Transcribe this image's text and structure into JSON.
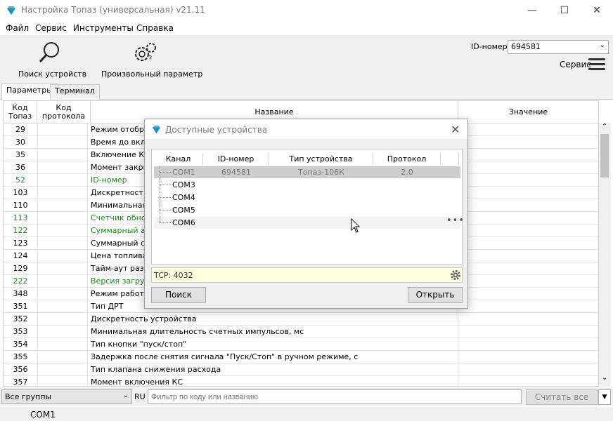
{
  "window": {
    "title": "Настройка Топаз (универсальная) v21.11",
    "minimize": "—",
    "maximize": "☐",
    "close": "✕"
  },
  "menu": [
    "Файл",
    "Сервис",
    "Инструменты",
    "Справка"
  ],
  "toolbar": {
    "search_label": "Поиск устройств",
    "param_label": "Произвольный параметр",
    "id_label": "ID-номер",
    "id_value": "694581",
    "service_label": "Сервис"
  },
  "tabs": [
    "Параметры",
    "Терминал"
  ],
  "grid": {
    "headers": {
      "code": "Код\nТопаз",
      "proto": "Код\nпротокола",
      "name": "Название",
      "value": "Значение"
    },
    "rows": [
      {
        "code": "29",
        "name": "Режим отображ",
        "green": false
      },
      {
        "code": "30",
        "name": "Время до вклю",
        "green": false
      },
      {
        "code": "35",
        "name": "Включение КМ",
        "green": false
      },
      {
        "code": "36",
        "name": "Момент закрыт",
        "green": false
      },
      {
        "code": "52",
        "name": "ID-номер",
        "green": true
      },
      {
        "code": "103",
        "name": "Дискретность",
        "green": false
      },
      {
        "code": "110",
        "name": "Минимальная д",
        "green": false
      },
      {
        "code": "113",
        "name": "Счетчик обнов",
        "green": true
      },
      {
        "code": "122",
        "name": "Суммарный ава",
        "green": true
      },
      {
        "code": "123",
        "name": "Суммарный сче",
        "green": false
      },
      {
        "code": "124",
        "name": "Цена топлива,",
        "green": false
      },
      {
        "code": "129",
        "name": "Тайм-аут разре",
        "green": false
      },
      {
        "code": "222",
        "name": "Версия загрузч",
        "green": true
      },
      {
        "code": "348",
        "name": "Режим работы",
        "green": false
      },
      {
        "code": "351",
        "name": "Тип ДРТ",
        "green": false
      },
      {
        "code": "352",
        "name": "Дискретность устройства",
        "green": false
      },
      {
        "code": "353",
        "name": "Минимальная длительность счетных импульсов, мс",
        "green": false
      },
      {
        "code": "354",
        "name": "Тип кнопки \"пуск/стоп\"",
        "green": false
      },
      {
        "code": "355",
        "name": "Задержка после снятия сигнала \"Пуск/Стоп\" в ручном режиме, с",
        "green": false
      },
      {
        "code": "356",
        "name": "Тип клапана снижения расхода",
        "green": false
      },
      {
        "code": "357",
        "name": "Момент включения КС",
        "green": false
      }
    ]
  },
  "filter": {
    "group": "Все группы",
    "lang": "RU",
    "placeholder": "Фильтр по коду или названию",
    "read_all": "Считать все"
  },
  "status": {
    "port": "COM1"
  },
  "dialog": {
    "title": "Доступные устройства",
    "headers": {
      "channel": "Канал",
      "id": "ID-номер",
      "type": "Тип устройства",
      "protocol": "Протокол"
    },
    "devices": [
      {
        "channel": "COM1",
        "id": "694581",
        "type": "Топаз-106К",
        "protocol": "2.0"
      },
      {
        "channel": "COM3",
        "id": "",
        "type": "",
        "protocol": ""
      },
      {
        "channel": "COM4",
        "id": "",
        "type": "",
        "protocol": ""
      },
      {
        "channel": "COM5",
        "id": "",
        "type": "",
        "protocol": ""
      },
      {
        "channel": "COM6",
        "id": "",
        "type": "",
        "protocol": ""
      }
    ],
    "tcp": "TCP: 4032",
    "search_btn": "Поиск",
    "open_btn": "Открыть"
  }
}
